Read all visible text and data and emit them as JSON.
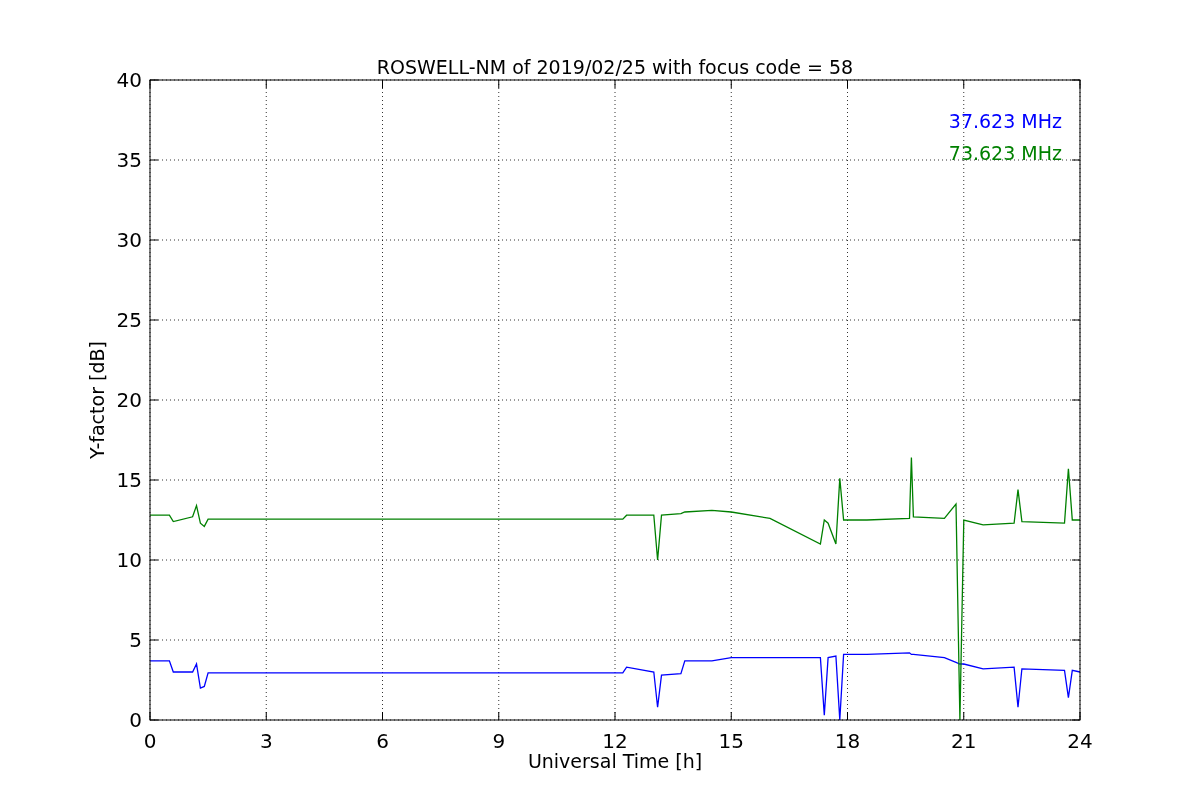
{
  "chart_data": {
    "type": "line",
    "title": "ROSWELL-NM of 2019/02/25 with focus code = 58",
    "xlabel": "Universal Time [h]",
    "ylabel": "Y-factor [dB]",
    "x": [
      0,
      0.5,
      0.6,
      1.1,
      1.2,
      1.3,
      1.4,
      1.5,
      3,
      6,
      9,
      12.2,
      12.3,
      13.0,
      13.1,
      13.2,
      13.7,
      13.8,
      14.5,
      15,
      16,
      17.3,
      17.4,
      17.5,
      17.7,
      17.8,
      17.9,
      18.5,
      19.6,
      19.65,
      19.7,
      20.5,
      20.8,
      20.9,
      21.0,
      21.5,
      22.3,
      22.4,
      22.5,
      23.6,
      23.7,
      23.8,
      24
    ],
    "series": [
      {
        "name": "37.623 MHz",
        "color": "#0000ff",
        "values": [
          3.7,
          3.7,
          3.0,
          3.0,
          3.5,
          2.0,
          2.1,
          2.95,
          2.95,
          2.95,
          2.95,
          2.95,
          3.3,
          3.0,
          0.8,
          2.8,
          2.9,
          3.7,
          3.7,
          3.9,
          3.9,
          3.9,
          0.3,
          3.9,
          4.0,
          0,
          4.1,
          4.1,
          4.2,
          4.1,
          4.1,
          3.9,
          3.6,
          3.5,
          3.5,
          3.2,
          3.3,
          0.8,
          3.2,
          3.1,
          1.4,
          3.1,
          3.0
        ]
      },
      {
        "name": "73.623 MHz",
        "color": "#008000",
        "values": [
          12.8,
          12.8,
          12.4,
          12.7,
          13.4,
          12.3,
          12.1,
          12.55,
          12.55,
          12.55,
          12.55,
          12.55,
          12.8,
          12.8,
          10.0,
          12.8,
          12.9,
          13.0,
          13.1,
          13.0,
          12.6,
          11.0,
          12.5,
          12.3,
          11.0,
          15.1,
          12.5,
          12.5,
          12.6,
          16.4,
          12.7,
          12.6,
          13.5,
          0,
          12.5,
          12.2,
          12.3,
          14.4,
          12.4,
          12.3,
          15.7,
          12.5,
          12.5
        ]
      }
    ],
    "grid": true,
    "xlim": [
      0,
      24
    ],
    "ylim": [
      0,
      40
    ],
    "xticks": [
      0,
      3,
      6,
      9,
      12,
      15,
      18,
      21,
      24
    ],
    "yticks": [
      0,
      5,
      10,
      15,
      20,
      25,
      30,
      35,
      40
    ]
  }
}
